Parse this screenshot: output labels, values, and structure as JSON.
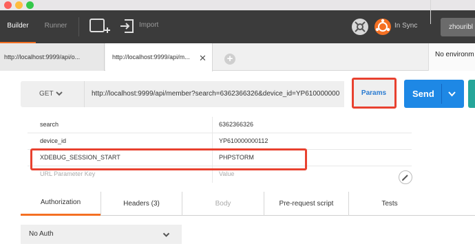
{
  "toolbar": {
    "builder_label": "Builder",
    "runner_label": "Runner",
    "import_label": "Import",
    "sync_label": "In Sync",
    "user_label": "zhouribl"
  },
  "tabs": [
    {
      "label": "http://localhost:9999/api/o..."
    },
    {
      "label": "http://localhost:9999/api/m..."
    }
  ],
  "environment": {
    "label": "No environm"
  },
  "request": {
    "method": "GET",
    "url": "http://localhost:9999/api/member?search=6362366326&device_id=YP610000000",
    "params_label": "Params",
    "send_label": "Send"
  },
  "params": [
    {
      "key": "search",
      "value": "6362366326"
    },
    {
      "key": "device_id",
      "value": "YP610000000112"
    },
    {
      "key": "XDEBUG_SESSION_START",
      "value": "PHPSTORM"
    }
  ],
  "params_placeholder": {
    "key": "URL Parameter Key",
    "value": "Value"
  },
  "section_tabs": [
    {
      "label": "Authorization"
    },
    {
      "label": "Headers (3)"
    },
    {
      "label": "Body"
    },
    {
      "label": "Pre-request script"
    },
    {
      "label": "Tests"
    }
  ],
  "auth": {
    "type": "No Auth"
  },
  "icons": {
    "new_window": "new-window-icon",
    "import": "import-icon",
    "interceptor": "interceptor-icon",
    "sync": "sync-icon",
    "chevron": "chevron-down-icon",
    "add_tab": "plus-icon",
    "bulk_edit": "pencil-icon"
  },
  "colors": {
    "accent": "#f47023",
    "send": "#1e88e5",
    "highlight": "#e8412f",
    "params_text": "#2a7bd1"
  }
}
